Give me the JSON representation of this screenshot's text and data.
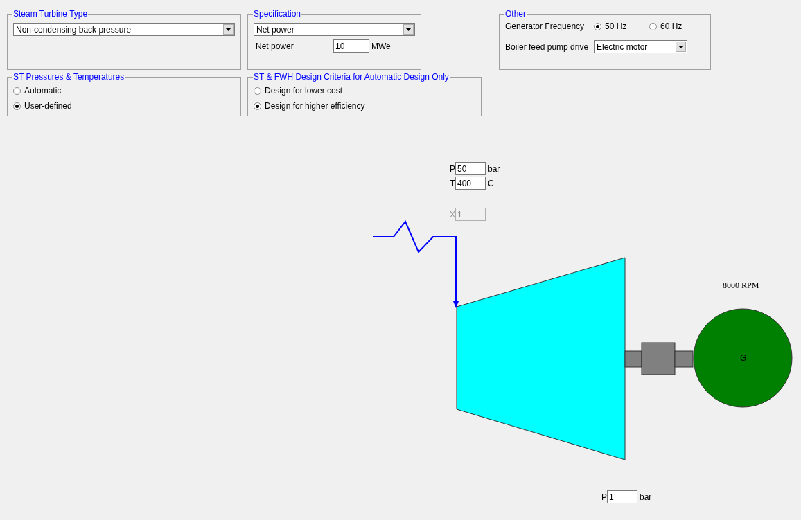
{
  "steam_turbine_type": {
    "title": "Steam Turbine Type",
    "dropdown": "Non-condensing back pressure"
  },
  "specification": {
    "title": "Specification",
    "dropdown": "Net power",
    "field": {
      "label": "Net power",
      "value": "10",
      "unit": "MWe"
    }
  },
  "other": {
    "title": "Other",
    "generator_frequency": {
      "label": "Generator Frequency",
      "options": [
        {
          "label": "50 Hz",
          "selected": true
        },
        {
          "label": "60 Hz",
          "selected": false
        }
      ]
    },
    "boiler_feed_pump_drive": {
      "label": "Boiler feed pump drive",
      "dropdown": "Electric motor"
    }
  },
  "st_pressures_temperatures": {
    "title": "ST Pressures & Temperatures",
    "options": [
      {
        "label": "Automatic",
        "selected": false
      },
      {
        "label": "User-defined",
        "selected": true
      }
    ]
  },
  "design_criteria": {
    "title": "ST & FWH Design Criteria for Automatic Design Only",
    "options": [
      {
        "label": "Design for lower cost",
        "selected": false
      },
      {
        "label": "Design for higher efficiency",
        "selected": true
      }
    ]
  },
  "diagram": {
    "inlet": [
      {
        "label": "P",
        "value": "50",
        "unit": "bar"
      },
      {
        "label": "T",
        "value": "400",
        "unit": "C"
      }
    ],
    "quality": {
      "label": "X",
      "value": "1",
      "disabled": true
    },
    "speed": "8000 RPM",
    "generator": "G",
    "outlet": {
      "label": "P",
      "value": "1",
      "unit": "bar"
    }
  }
}
